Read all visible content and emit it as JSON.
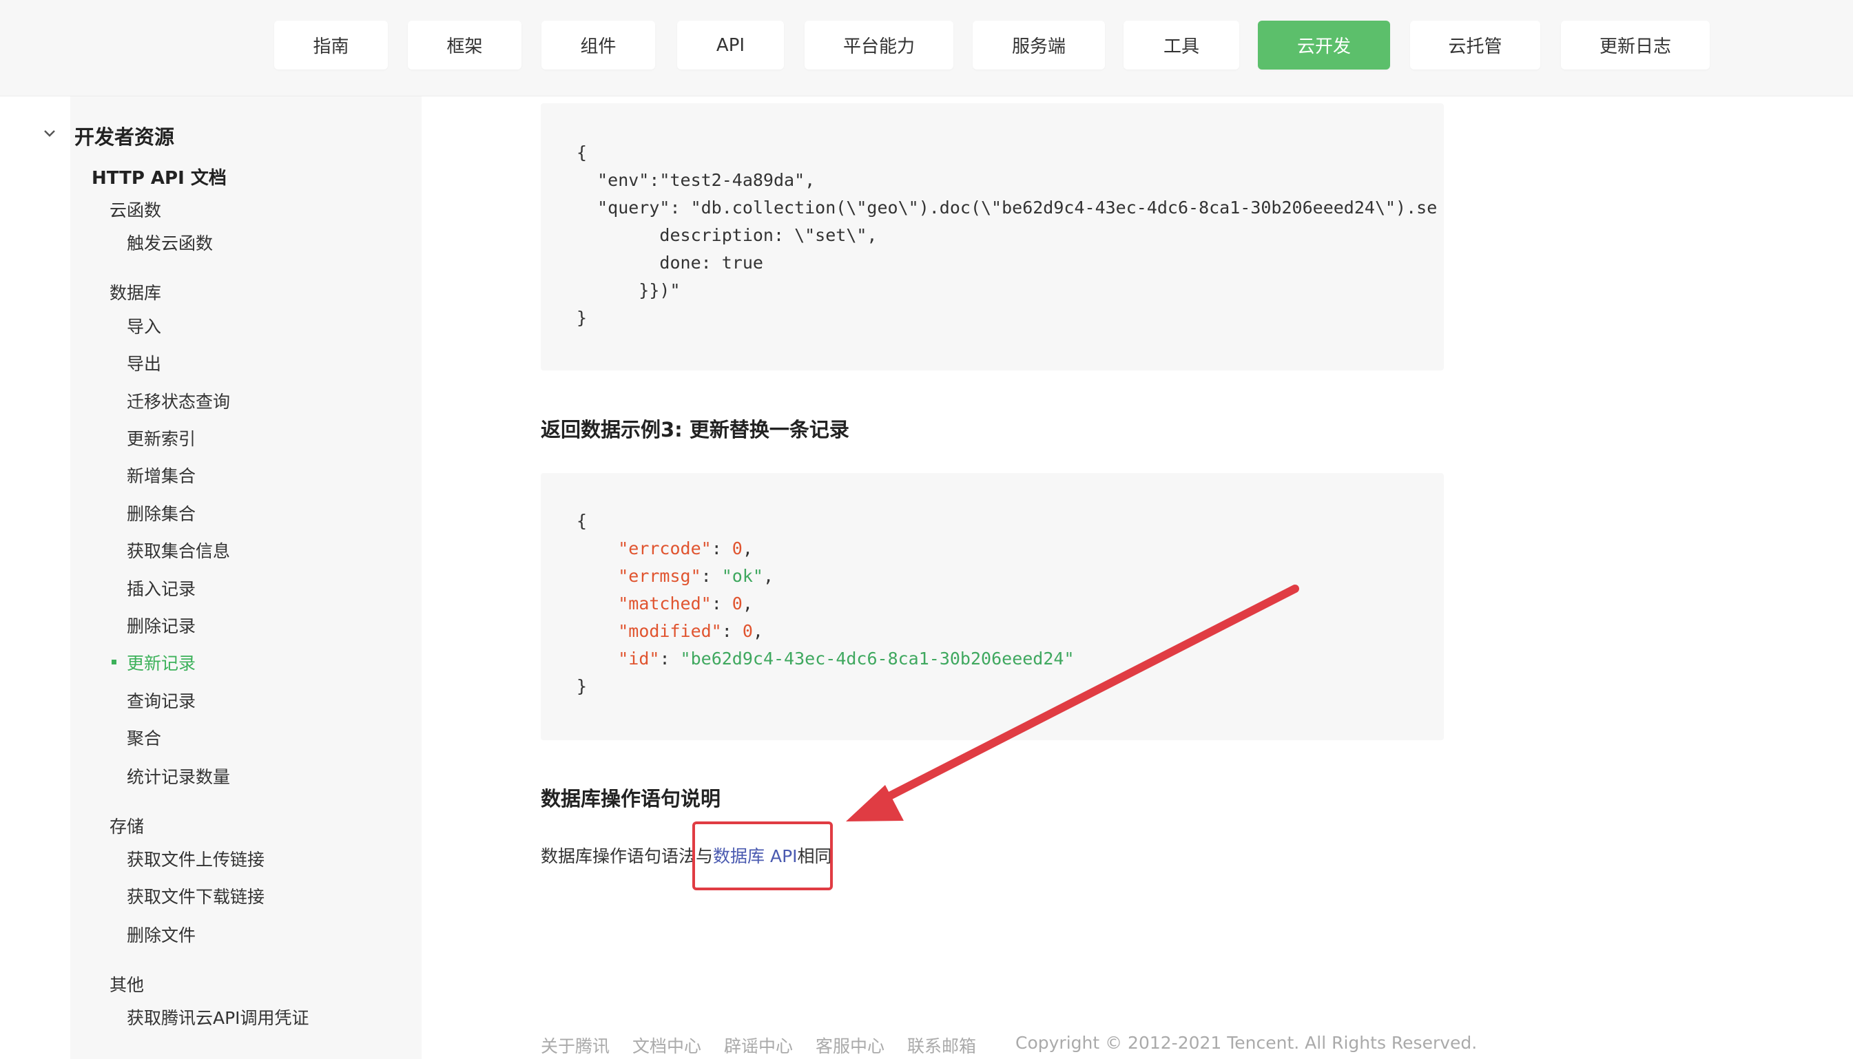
{
  "nav": {
    "tabs": [
      {
        "label": "指南"
      },
      {
        "label": "框架"
      },
      {
        "label": "组件"
      },
      {
        "label": "API"
      },
      {
        "label": "平台能力"
      },
      {
        "label": "服务端"
      },
      {
        "label": "工具"
      },
      {
        "label": "云开发"
      },
      {
        "label": "云托管"
      },
      {
        "label": "更新日志"
      }
    ],
    "active_tab": "云开发",
    "accent_color": "#5cbf6b"
  },
  "sidebar": {
    "root_label": "开发者资源",
    "http_api_label": "HTTP API 文档",
    "groups": [
      {
        "label": "云函数",
        "items": [
          "触发云函数"
        ]
      },
      {
        "label": "数据库",
        "items": [
          "导入",
          "导出",
          "迁移状态查询",
          "更新索引",
          "新增集合",
          "删除集合",
          "获取集合信息",
          "插入记录",
          "删除记录",
          "更新记录",
          "查询记录",
          "聚合",
          "统计记录数量"
        ]
      },
      {
        "label": "存储",
        "items": [
          "获取文件上传链接",
          "获取文件下载链接",
          "删除文件"
        ]
      },
      {
        "label": "其他",
        "items": [
          "获取腾讯云API调用凭证"
        ]
      }
    ],
    "active_item": "更新记录",
    "active_color": "#3cb15a"
  },
  "content": {
    "code1": {
      "line1": "{",
      "line2": "  \"env\":\"test2-4a89da\",",
      "line3": "  \"query\": \"db.collection(\\\"geo\\\").doc(\\\"be62d9c4-43ec-4dc6-8ca1-30b206eeed24\\\").se",
      "line4": "        description: \\\"set\\\",",
      "line5": "        done: true",
      "line6": "      }})\"",
      "line7": "}"
    },
    "example3_heading": "返回数据示例3: 更新替换一条记录",
    "code2": {
      "open": "{",
      "errcode_key": "\"errcode\"",
      "errcode_val": "0",
      "errmsg_key": "\"errmsg\"",
      "errmsg_val": "\"ok\"",
      "matched_key": "\"matched\"",
      "matched_val": "0",
      "modified_key": "\"modified\"",
      "modified_val": "0",
      "id_key": "\"id\"",
      "id_val": "\"be62d9c4-43ec-4dc6-8ca1-30b206eeed24\"",
      "close": "}"
    },
    "section_heading": "数据库操作语句说明",
    "para_prefix": "数据库操作语句语法与",
    "para_link": "数据库 API",
    "para_suffix": "相同"
  },
  "annotation": {
    "color": "#e03c43",
    "arrow": "red arrow pointing to highlighted link",
    "box": "red rectangle around link"
  },
  "footer": {
    "links": [
      "关于腾讯",
      "文档中心",
      "辟谣中心",
      "客服中心",
      "联系邮箱"
    ],
    "copyright": "Copyright © 2012-2021 Tencent. All Rights Reserved."
  }
}
